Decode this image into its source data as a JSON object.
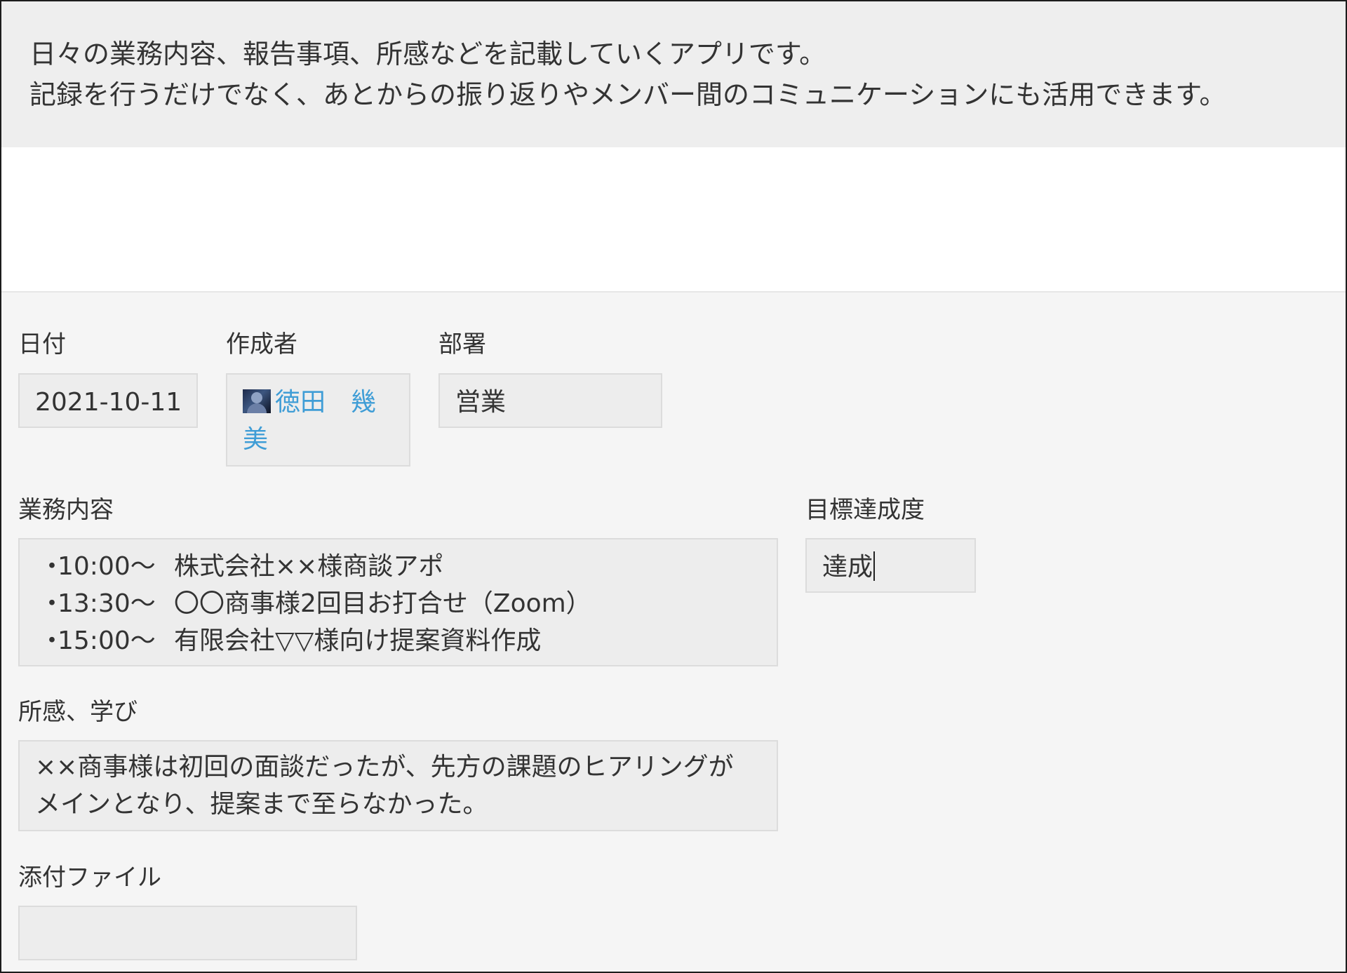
{
  "app_description": {
    "line1": "日々の業務内容、報告事項、所感などを記載していくアプリです。",
    "line2": "記録を行うだけでなく、あとからの振り返りやメンバー間のコミュニケーションにも活用できます。"
  },
  "fields": {
    "date": {
      "label": "日付",
      "value": "2021-10-11"
    },
    "creator": {
      "label": "作成者",
      "name": "徳田　幾美"
    },
    "department": {
      "label": "部署",
      "value": "営業"
    },
    "work": {
      "label": "業務内容",
      "items": [
        {
          "bullet": "・",
          "time": "10:00～",
          "text": "株式会社××様商談アポ"
        },
        {
          "bullet": "・",
          "time": "13:30～",
          "text": "〇〇商事様2回目お打合せ（Zoom）"
        },
        {
          "bullet": "・",
          "time": "15:00～",
          "text": "有限会社▽▽様向け提案資料作成"
        }
      ]
    },
    "achievement": {
      "label": "目標達成度",
      "value": "達成"
    },
    "impression": {
      "label": "所感、学び",
      "value": "××商事様は初回の面談だったが、先方の課題のヒアリングがメインとなり、提案まで至らなかった。"
    },
    "attachment": {
      "label": "添付ファイル"
    }
  }
}
